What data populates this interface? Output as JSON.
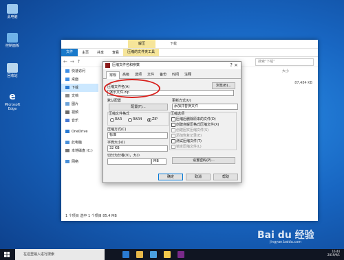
{
  "desktop": {
    "icons": [
      {
        "label": "此电脑",
        "icon": "computer-icon"
      },
      {
        "label": "控制面板",
        "icon": "control-panel-icon"
      },
      {
        "label": "回收站",
        "icon": "recycle-bin-icon"
      },
      {
        "label": "Microsoft Edge",
        "icon": "edge-icon"
      }
    ]
  },
  "explorer": {
    "context_tab": "解压",
    "title": "下载",
    "ribbon": [
      "文件",
      "主页",
      "共享",
      "查看",
      "压缩的文件夹工具"
    ],
    "search_placeholder": "搜索\"下载\"",
    "nav_items": [
      {
        "label": "快速访问",
        "color": "#3d8ee6"
      },
      {
        "label": "桌面",
        "color": "#3d8ee6"
      },
      {
        "label": "下载",
        "color": "#2a7bd3"
      },
      {
        "label": "文档",
        "color": "#8a8a8a"
      },
      {
        "label": "图片",
        "color": "#6aa1d8"
      },
      {
        "label": "视频",
        "color": "#6a6a6a"
      },
      {
        "label": "音乐",
        "color": "#4a7bd3"
      },
      {
        "label": "OneDrive",
        "color": "#2a7bd3"
      },
      {
        "label": "此电脑",
        "color": "#4a90d9"
      },
      {
        "label": "本地磁盘 (C:)",
        "color": "#777777"
      },
      {
        "label": "网络",
        "color": "#4a90d9"
      }
    ],
    "column_header": "大小",
    "file_size": "87,484 KB",
    "status": "1 个项目    选中 1 个项目  85.4 MB"
  },
  "dialog": {
    "title": "压缩文件名和参数",
    "close": "?  ×",
    "tabs": [
      "常规",
      "高级",
      "选项",
      "文件",
      "备份",
      "时间",
      "注释"
    ],
    "archive_name_label": "压缩文件名(A)",
    "browse": "浏览(B)...",
    "archive_name_value": "演示文件.zip",
    "profile_label": "默认配置",
    "profile_button": "配置(F)...",
    "update_label": "更新方式(U)",
    "update_value": "添加并替换文件",
    "format_label": "压缩文件格式",
    "formats": [
      "RAR",
      "RAR4",
      "ZIP"
    ],
    "method_label": "压缩方式(C)",
    "method_value": "标准",
    "dict_label": "字典大小(I)",
    "dict_value": "32 KB",
    "split_label": "切分为分卷(V)，大小",
    "split_unit": "MB",
    "options_label": "压缩选项",
    "options": [
      "压缩后删除原来的文件(D)",
      "创建自解压格式压缩文件(X)",
      "创建固实压缩文件(S)",
      "添加恢复记录(E)",
      "测试压缩文件(T)",
      "锁定压缩文件(L)"
    ],
    "password_button": "设置密码(P)...",
    "ok": "确定",
    "cancel": "取消",
    "help": "帮助"
  },
  "taskbar": {
    "search_placeholder": "在这里输入进行搜索",
    "time": "16:44",
    "date": "2019/9/1"
  },
  "watermark": {
    "brand": "Bai du 经验",
    "url": "jingyan.baidu.com"
  }
}
